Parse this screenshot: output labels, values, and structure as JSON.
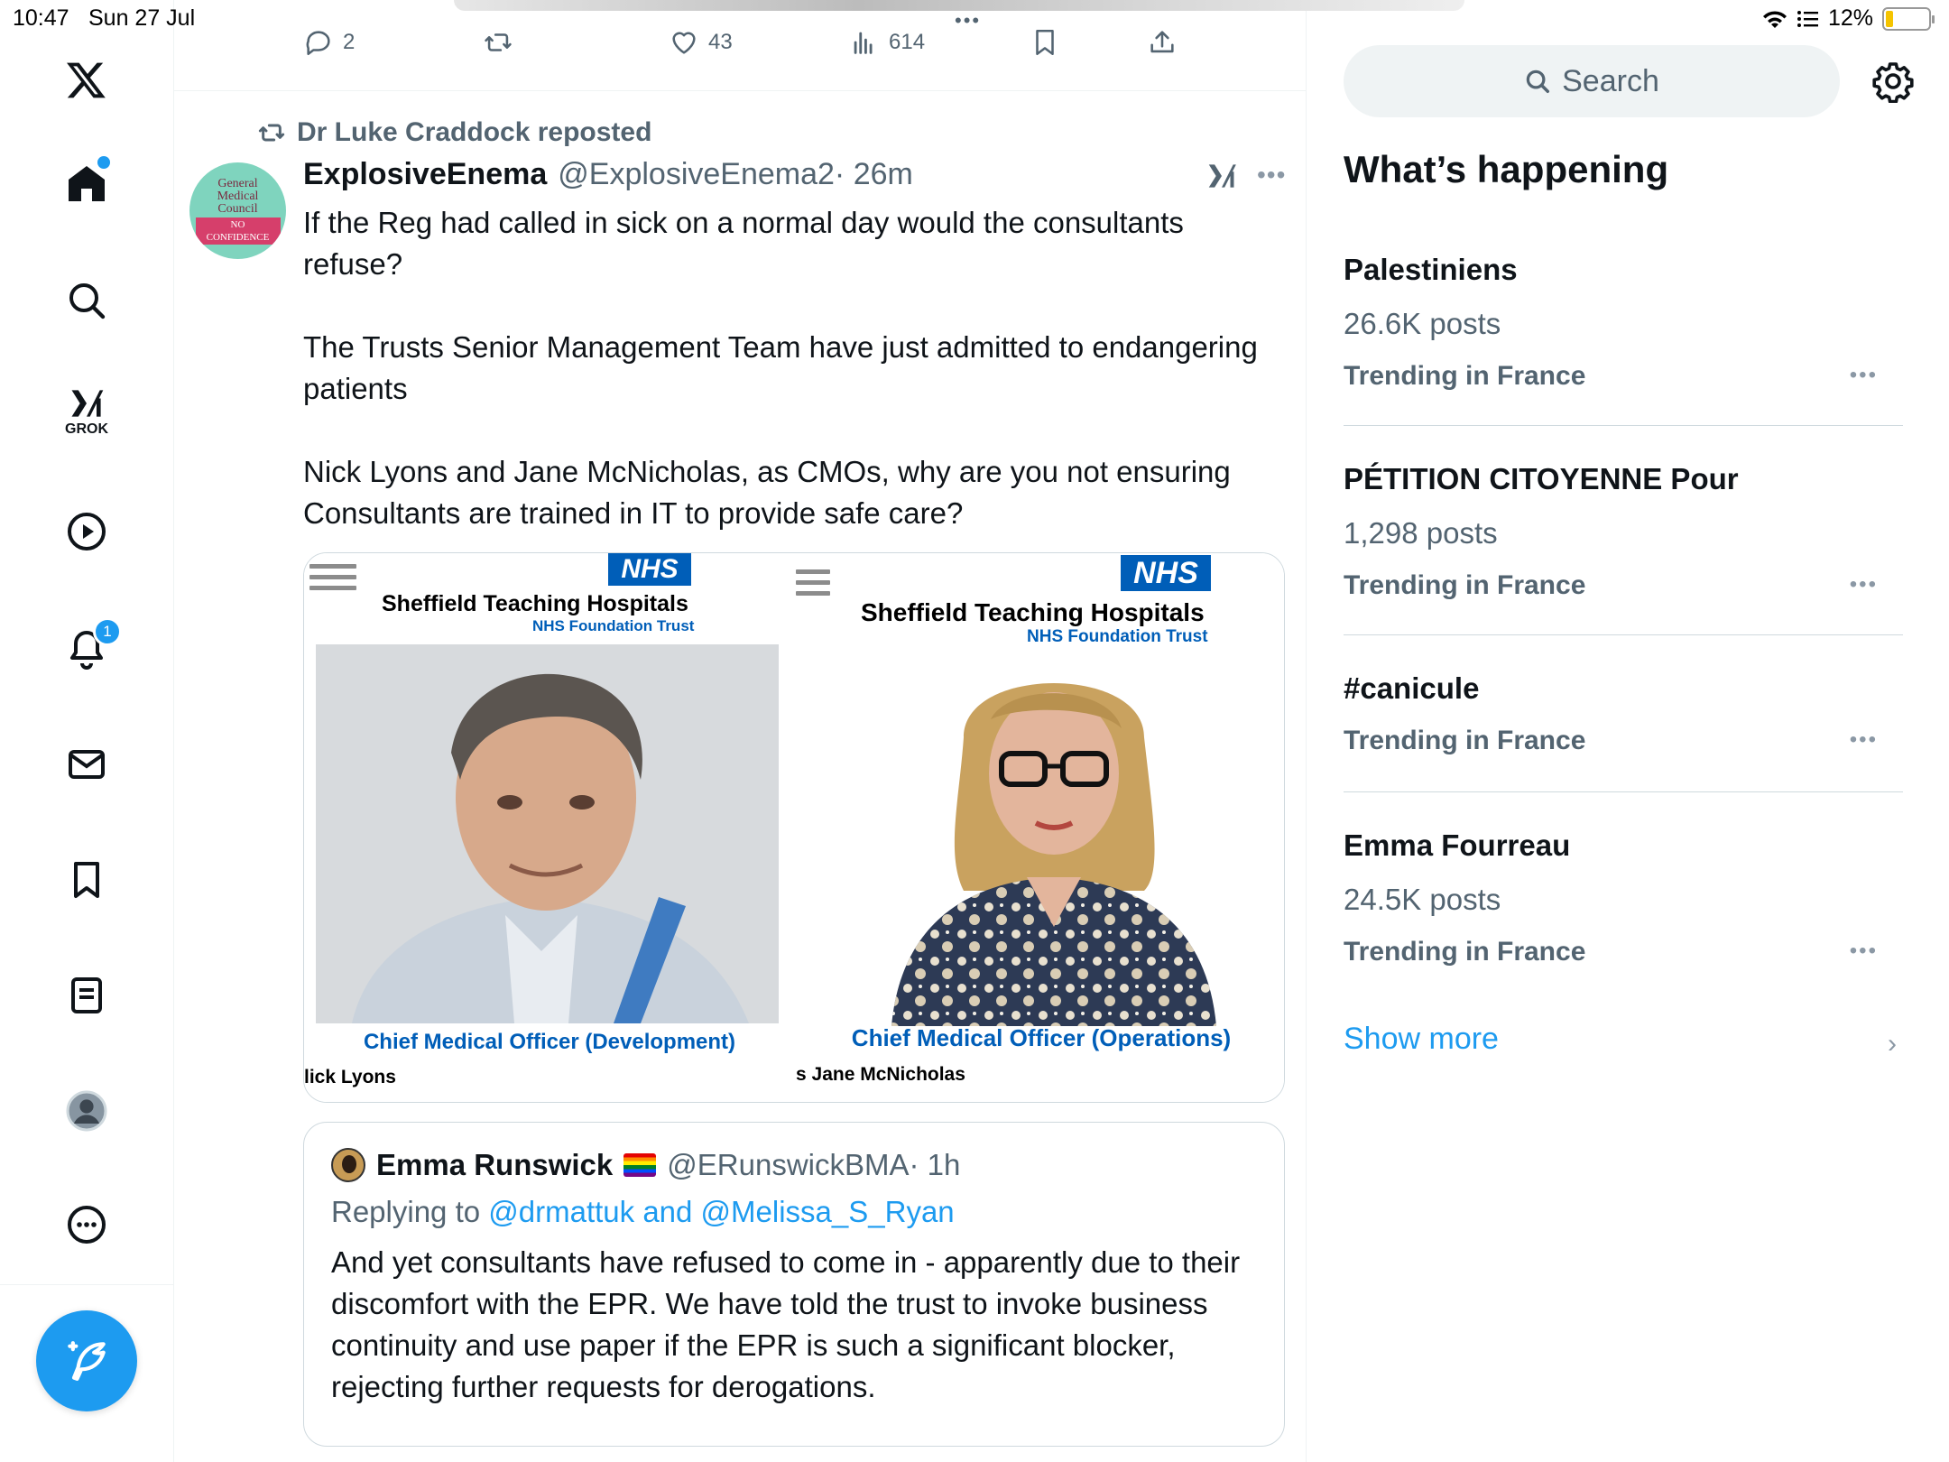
{
  "status_bar": {
    "time": "10:47",
    "date": "Sun 27 Jul",
    "battery": "12%",
    "battery_level": 0.12
  },
  "nav": {
    "grok_label": "GROK",
    "notification_count": "1"
  },
  "prev_tweet_actions": {
    "replies": "2",
    "retweets": "",
    "likes": "43",
    "views": "614"
  },
  "tweet": {
    "repost_by": "Dr Luke Craddock reposted",
    "author_name": "ExplosiveEnema",
    "author_handle": "@ExplosiveEnema2",
    "time": "· 26m",
    "avatar_text": [
      "General",
      "Medical",
      "Council"
    ],
    "avatar_stamp": "NO CONFIDENCE",
    "paragraphs": [
      "If the Reg had called in sick on a normal day would the consultants refuse?",
      "The Trusts Senior Management Team have just admitted to endangering patients",
      "Nick Lyons and Jane McNicholas, as CMOs, why are you not ensuring Consultants are trained in IT to provide safe care?"
    ],
    "media": {
      "left": {
        "nhs": "NHS",
        "org": "Sheffield Teaching Hospitals",
        "trust": "NHS Foundation Trust",
        "role": "Chief Medical Officer (Development)",
        "name": "lick Lyons"
      },
      "right": {
        "nhs": "NHS",
        "org": "Sheffield Teaching Hospitals",
        "trust": "NHS Foundation Trust",
        "role": "Chief Medical Officer (Operations)",
        "name": "s Jane McNicholas"
      }
    },
    "quote": {
      "name": "Emma Runswick",
      "handle": "@ERunswickBMA",
      "time": "· 1h",
      "replying_prefix": "Replying to",
      "replying_mentions": "@drmattuk and @Melissa_S_Ryan",
      "text": "And yet consultants have refused to come in - apparently due to their discomfort with the EPR. We have told the trust to invoke business continuity and use paper if the EPR is such a significant blocker, rejecting further requests for derogations."
    }
  },
  "sidebar": {
    "search_placeholder": "Search",
    "title": "What’s happening",
    "trends": [
      {
        "name": "Palestiniens",
        "count": "26.6K posts",
        "context": "Trending in France"
      },
      {
        "name": "PÉTITION CITOYENNE Pour",
        "count": "1,298 posts",
        "context": "Trending in France"
      },
      {
        "name": "#canicule",
        "count": "",
        "context": "Trending in France"
      },
      {
        "name": "Emma Fourreau",
        "count": "24.5K posts",
        "context": "Trending in France"
      }
    ],
    "show_more": "Show more"
  },
  "colors": {
    "accent": "#1d9bf0",
    "nhs_blue": "#005eb8",
    "muted": "#536471"
  }
}
